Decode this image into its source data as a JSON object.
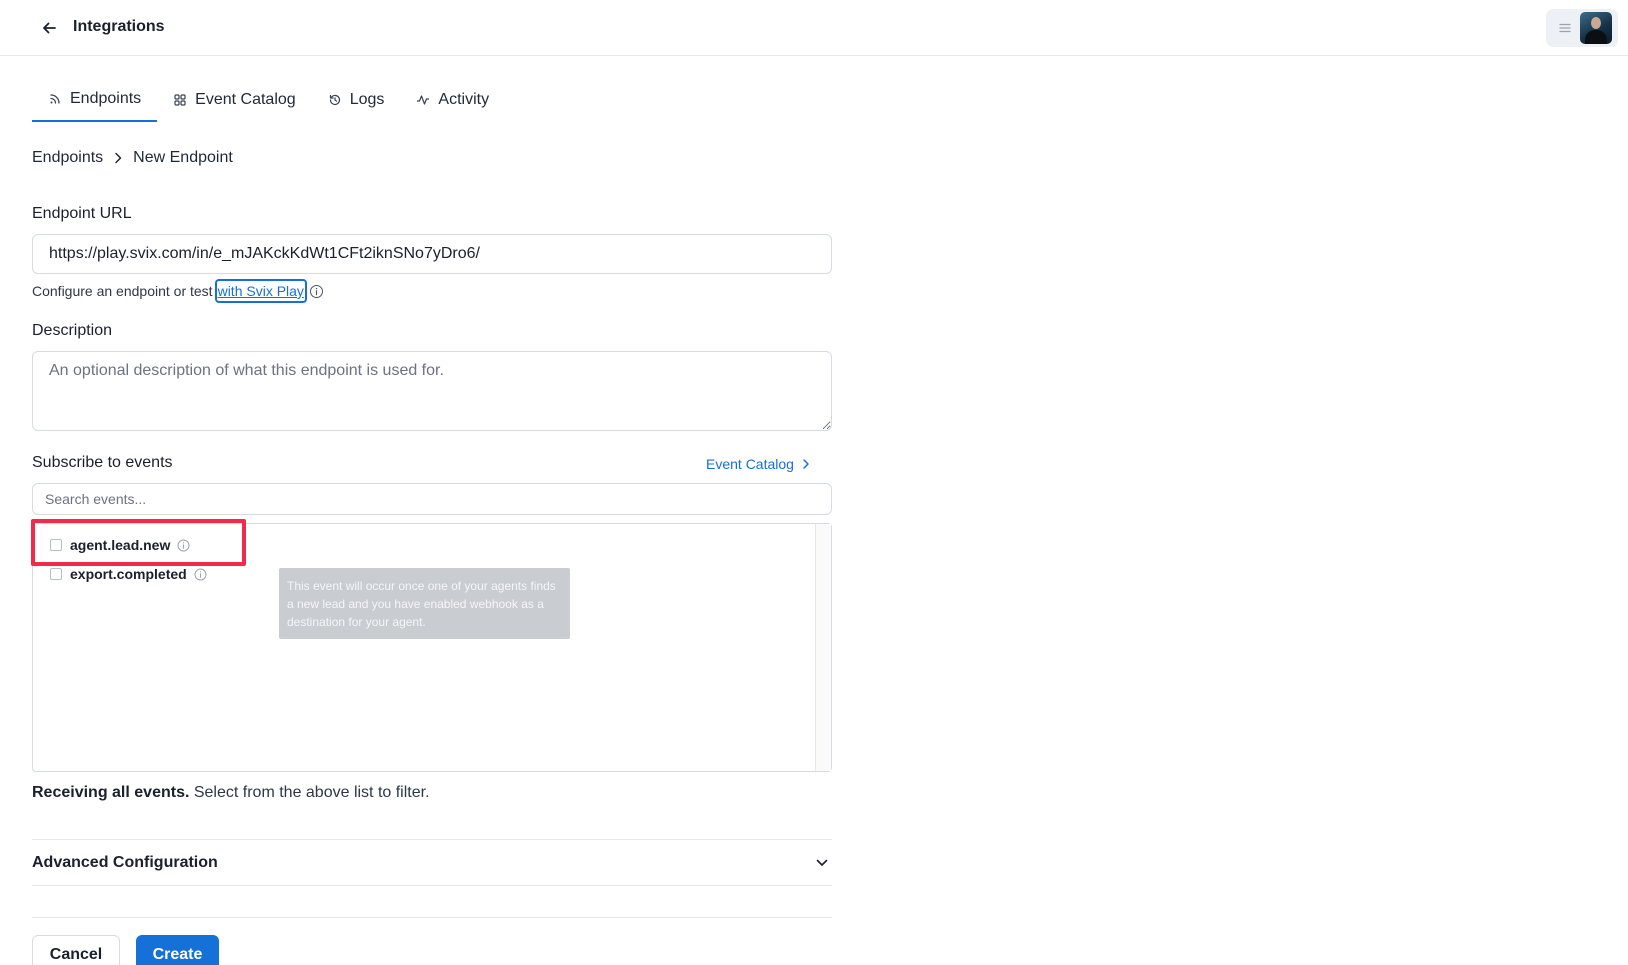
{
  "header": {
    "title": "Integrations",
    "back_icon": "arrow-left-icon",
    "menu_icon": "hamburger-icon"
  },
  "tabs": [
    {
      "label": "Endpoints",
      "icon": "rss-icon",
      "active": true
    },
    {
      "label": "Event Catalog",
      "icon": "grid-icon",
      "active": false
    },
    {
      "label": "Logs",
      "icon": "history-icon",
      "active": false
    },
    {
      "label": "Activity",
      "icon": "activity-icon",
      "active": false
    }
  ],
  "breadcrumb": {
    "parent": "Endpoints",
    "current": "New Endpoint"
  },
  "form": {
    "url_label": "Endpoint URL",
    "url_value": "https://play.svix.com/in/e_mJAKckKdWt1CFt2iknSNo7yDro6/",
    "help_text": "Configure an endpoint or test",
    "help_link": "with Svix Play",
    "description_label": "Description",
    "description_placeholder": "An optional description of what this endpoint is used for.",
    "subscribe_label": "Subscribe to events",
    "catalog_link": "Event Catalog",
    "search_placeholder": "Search events...",
    "events": [
      {
        "name": "agent.lead.new",
        "checked": false
      },
      {
        "name": "export.completed",
        "checked": false
      }
    ],
    "tooltip": "This event will occur once one of your agents finds a new lead and you have enabled webhook as a destination for your agent.",
    "receiving_bold": "Receiving all events.",
    "receiving_rest": "Select from the above list to filter.",
    "advanced_label": "Advanced Configuration"
  },
  "actions": {
    "cancel": "Cancel",
    "create": "Create"
  },
  "colors": {
    "accent": "#1570d8",
    "highlight": "#ef2a4a"
  }
}
